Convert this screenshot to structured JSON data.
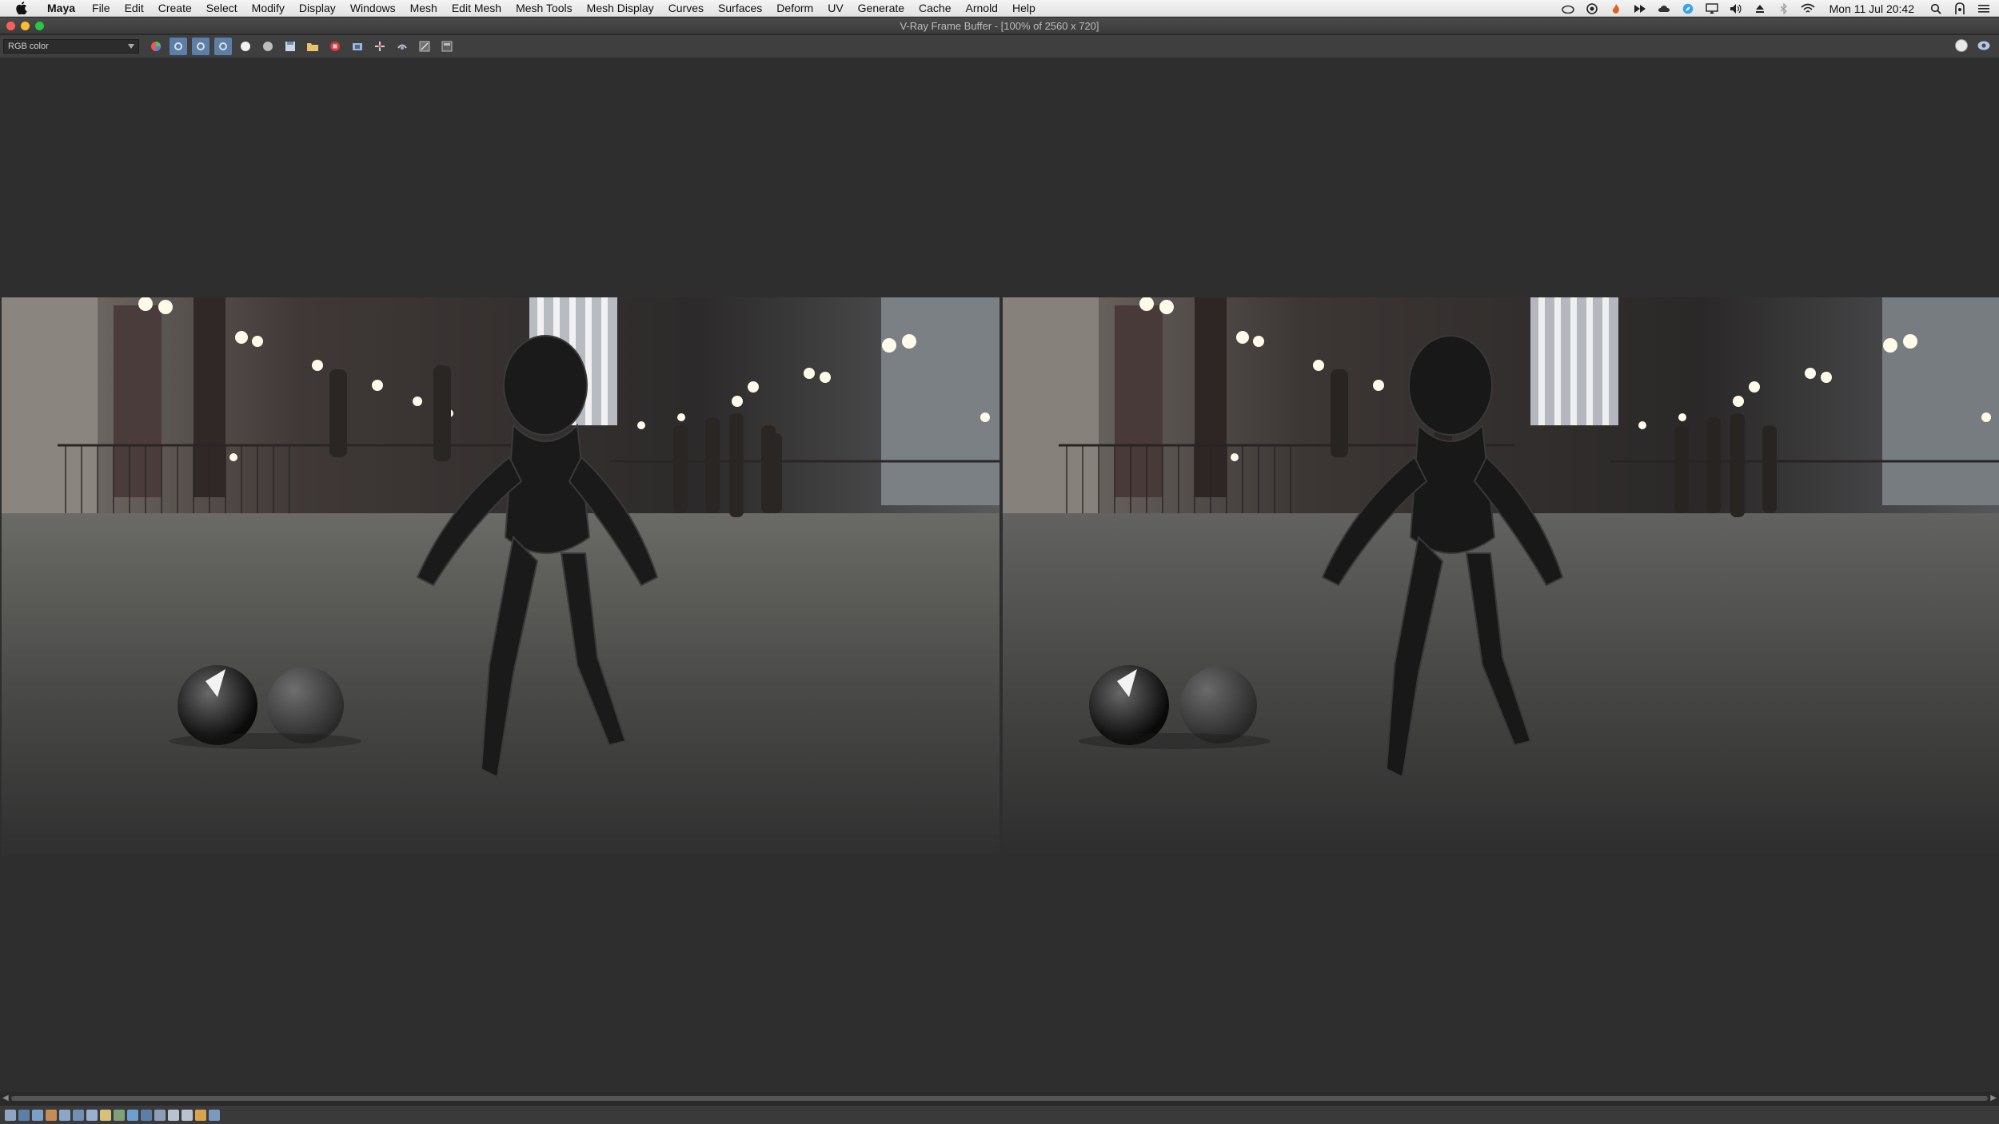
{
  "menubar": {
    "app_name": "Maya",
    "items": [
      "File",
      "Edit",
      "Create",
      "Select",
      "Modify",
      "Display",
      "Windows",
      "Mesh",
      "Edit Mesh",
      "Mesh Tools",
      "Mesh Display",
      "Curves",
      "Surfaces",
      "Deform",
      "UV",
      "Generate",
      "Cache",
      "Arnold",
      "Help"
    ],
    "clock": "Mon 11 Jul  20:42",
    "status_icons": [
      "creative-cloud-icon",
      "record-icon",
      "flame-icon",
      "forward-icon",
      "cloud-icon",
      "safari-icon",
      "display-icon",
      "volume-icon",
      "eject-icon",
      "bluetooth-icon",
      "wifi-icon",
      "search-icon",
      "user-icon",
      "list-icon"
    ]
  },
  "window": {
    "title": "V-Ray Frame Buffer - [100% of 2560 x 720]"
  },
  "toolbar": {
    "channel": "RGB color",
    "tools": [
      "color-wheel-icon",
      "red-channel-icon",
      "green-channel-icon",
      "blue-channel-icon",
      "white-circle-icon",
      "mono-circle-icon",
      "save-icon",
      "open-icon",
      "stop-render-icon",
      "region-icon",
      "track-mouse-icon",
      "link-icon",
      "clear-icon",
      "history-icon"
    ],
    "right_tools": [
      "lens-effects-icon",
      "eye-icon"
    ]
  },
  "colors": {
    "canvas_bg": "#2e2e2e",
    "toolbar_bg": "#3f3f3f",
    "accent": "#5b7fa8"
  }
}
